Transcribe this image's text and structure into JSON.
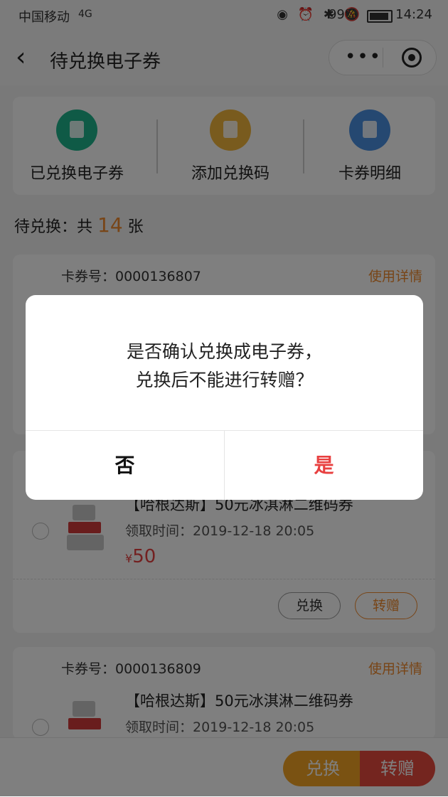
{
  "status_bar": {
    "carrier": "中国移动",
    "network": "4G",
    "battery": "99%",
    "time": "14:24"
  },
  "nav": {
    "title": "待兑换电子券"
  },
  "quick_actions": [
    {
      "label": "已兑换电子券",
      "icon": "document-icon",
      "color": "#1fb58c"
    },
    {
      "label": "添加兑换码",
      "icon": "ticket-icon",
      "color": "#f3b63c"
    },
    {
      "label": "卡券明细",
      "icon": "list-icon",
      "color": "#4a90e2"
    }
  ],
  "summary": {
    "prefix": "待兑换：共",
    "count": "14",
    "unit": "张"
  },
  "coupons": [
    {
      "card_no": "卡券号：0000136807",
      "detail_link": "使用详情"
    },
    {
      "title": "【哈根达斯】50元冰淇淋二维码券",
      "time": "领取时间：2019-12-18 20:05",
      "currency": "¥",
      "price": "50",
      "exchange_label": "兑换",
      "gift_label": "转赠"
    },
    {
      "card_no": "卡券号：0000136809",
      "detail_link": "使用详情",
      "title": "【哈根达斯】50元冰淇淋二维码券",
      "time": "领取时间：2019-12-18 20:05"
    }
  ],
  "bottom_bar": {
    "exchange_label": "兑换",
    "gift_label": "转赠"
  },
  "dialog": {
    "line1": "是否确认兑换成电子券，",
    "line2": "兑换后不能进行转赠？",
    "no_label": "否",
    "yes_label": "是",
    "yes_color": "#e84040"
  }
}
